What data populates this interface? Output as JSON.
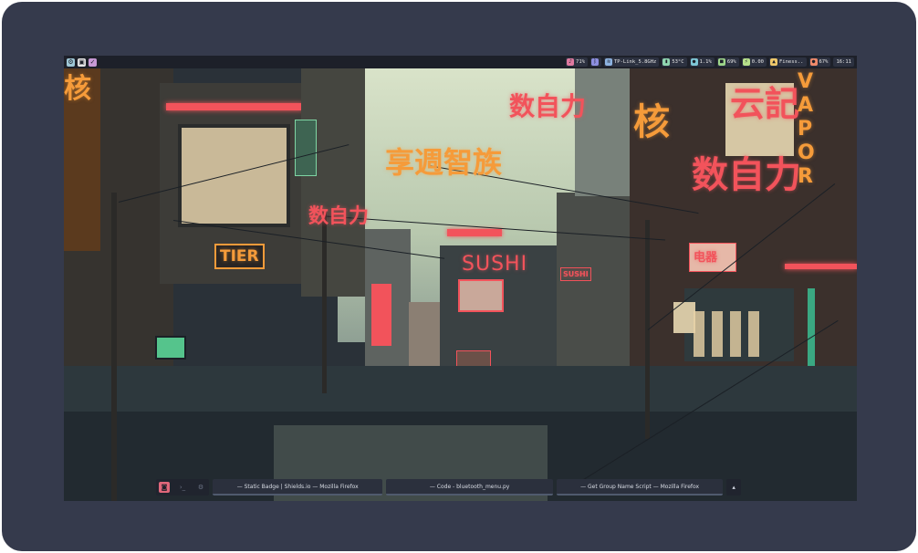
{
  "topbar": {
    "workspaces": [
      {
        "icon": "settings-icon",
        "glyph": "⚙",
        "color": "#9fc7d6"
      },
      {
        "icon": "terminal-icon",
        "glyph": "▣",
        "color": "#e6e6e6"
      },
      {
        "icon": "check-icon",
        "glyph": "✓",
        "color": "#c99ad6"
      }
    ],
    "modules": [
      {
        "name": "volume",
        "icon": "volume-icon",
        "glyph": "♪",
        "color": "#e07aa0",
        "text": "71%"
      },
      {
        "name": "bluetooth",
        "icon": "bluetooth-icon",
        "glyph": "ᛒ",
        "color": "#8d8fe0",
        "text": ""
      },
      {
        "name": "wifi",
        "icon": "wifi-icon",
        "glyph": "≋",
        "color": "#8db3e0",
        "text": "TP-Link_5.8GHz"
      },
      {
        "name": "temperature",
        "icon": "thermometer-icon",
        "glyph": "▮",
        "color": "#8fd6b0",
        "text": "53°C"
      },
      {
        "name": "cpu",
        "icon": "cpu-icon",
        "glyph": "●",
        "color": "#7ec7d6",
        "text": "1.1%"
      },
      {
        "name": "memory",
        "icon": "memory-icon",
        "glyph": "■",
        "color": "#9ed68a",
        "text": "69%"
      },
      {
        "name": "power",
        "icon": "bolt-icon",
        "glyph": "⚡",
        "color": "#b6e08a",
        "text": "0.00"
      },
      {
        "name": "media",
        "icon": "music-icon",
        "glyph": "▲",
        "color": "#f0c96a",
        "text": "Finess.."
      },
      {
        "name": "battery",
        "icon": "battery-icon",
        "glyph": "●",
        "color": "#f08a6a",
        "text": "67%"
      },
      {
        "name": "clock",
        "icon": "",
        "glyph": "",
        "color": "",
        "text": "16:11"
      }
    ]
  },
  "scene": {
    "signs": {
      "vapor": "VAPOR",
      "sushi": "SUSHI",
      "sushi_small": "SUSHI",
      "tier": "TIER",
      "cjk_1": "数自力",
      "cjk_2": "享週智族",
      "cjk_3": "数自力",
      "cjk_4": "核",
      "cjk_5": "云記",
      "cjk_6": "数自力",
      "cjk_7": "电器"
    }
  },
  "taskbar": {
    "windows": [
      {
        "label": "— Static Badge | Shields.io — Mozilla Firefox"
      },
      {
        "label": "— Code - bluetooth_menu.py"
      },
      {
        "label": "— Get Group Name Script — Mozilla Firefox"
      }
    ],
    "menu_glyph": "▴"
  }
}
